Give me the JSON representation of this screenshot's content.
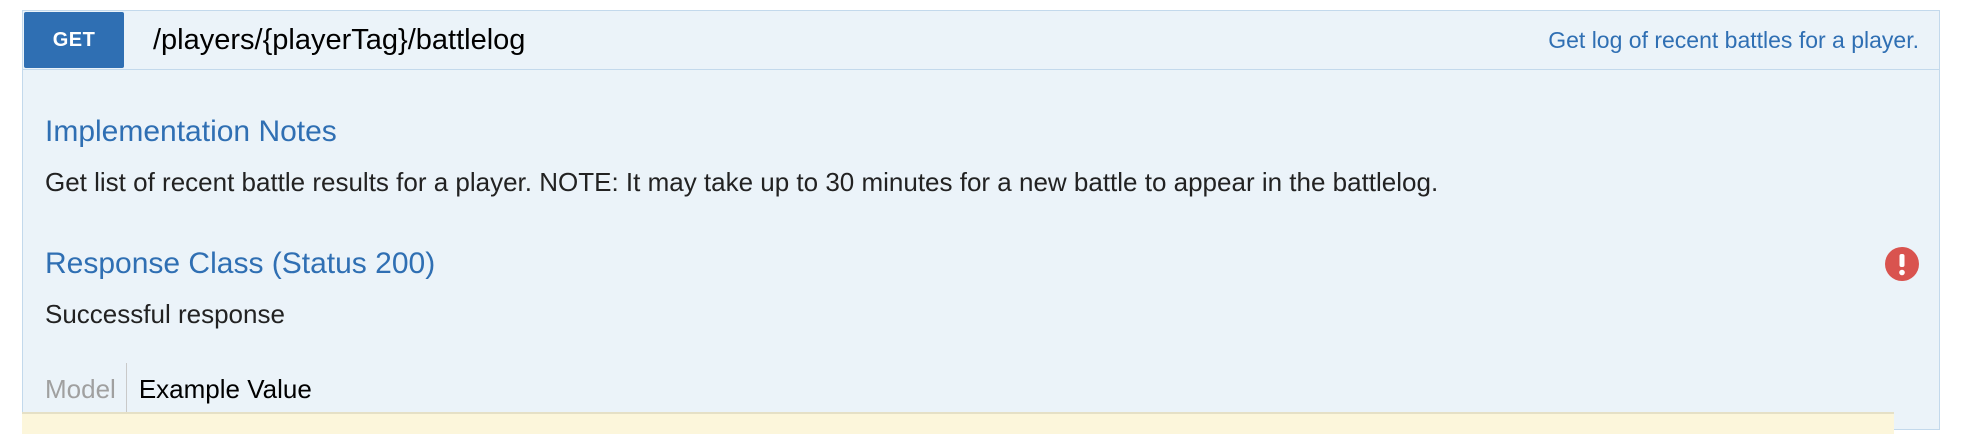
{
  "endpoint": {
    "method": "GET",
    "path": "/players/{playerTag}/battlelog",
    "summary": "Get log of recent battles for a player."
  },
  "implementation_notes": {
    "title": "Implementation Notes",
    "text": "Get list of recent battle results for a player. NOTE: It may take up to 30 minutes for a new battle to appear in the battlelog."
  },
  "response_class": {
    "title": "Response Class (Status 200)",
    "text": "Successful response",
    "icon": "error-icon"
  },
  "tabs": {
    "model": "Model",
    "example": "Example Value"
  },
  "colors": {
    "method_bg": "#2f6fb3",
    "link": "#2f6fb3",
    "panel_bg": "#ebf3f9",
    "error": "#d9534f"
  }
}
